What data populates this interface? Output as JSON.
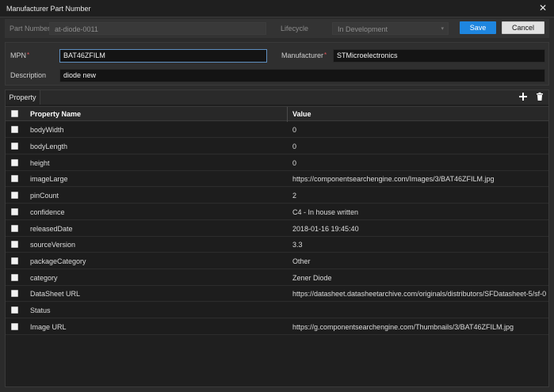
{
  "window": {
    "title": "Manufacturer Part Number"
  },
  "toprow": {
    "part_number_label": "Part Number",
    "part_number_value": "at-diode-0011",
    "lifecycle_label": "Lifecycle",
    "lifecycle_value": "In Development",
    "save_label": "Save",
    "cancel_label": "Cancel"
  },
  "form": {
    "mpn_label": "MPN",
    "mpn_value": "BAT46ZFILM",
    "manufacturer_label": "Manufacturer",
    "manufacturer_value": "STMicroelectronics",
    "description_label": "Description",
    "description_value": "diode new",
    "required_mark": "*"
  },
  "grid": {
    "tab_label": "Property",
    "columns": {
      "name": "Property Name",
      "value": "Value"
    },
    "rows": [
      {
        "name": "bodyWidth",
        "value": "0"
      },
      {
        "name": "bodyLength",
        "value": "0"
      },
      {
        "name": "height",
        "value": "0"
      },
      {
        "name": "imageLarge",
        "value": "https://componentsearchengine.com/Images/3/BAT46ZFILM.jpg"
      },
      {
        "name": "pinCount",
        "value": "2"
      },
      {
        "name": "confidence",
        "value": "C4 - In house written"
      },
      {
        "name": "releasedDate",
        "value": "2018-01-16 19:45:40"
      },
      {
        "name": "sourceVersion",
        "value": "3.3"
      },
      {
        "name": "packageCategory",
        "value": "Other"
      },
      {
        "name": "category",
        "value": "Zener Diode"
      },
      {
        "name": "DataSheet URL",
        "value": "https://datasheet.datasheetarchive.com/originals/distributors/SFDatasheet-5/sf-0"
      },
      {
        "name": "Status",
        "value": ""
      },
      {
        "name": "Image URL",
        "value": "https://g.componentsearchengine.com/Thumbnails/3/BAT46ZFILM.jpg"
      }
    ]
  },
  "icons": {
    "close": "close-icon",
    "add": "plus-icon",
    "delete": "trash-icon",
    "dropdown": "chevron-down-icon"
  },
  "colors": {
    "accent": "#1e86e0",
    "required": "#e0555a",
    "background": "#2b2b2b"
  }
}
